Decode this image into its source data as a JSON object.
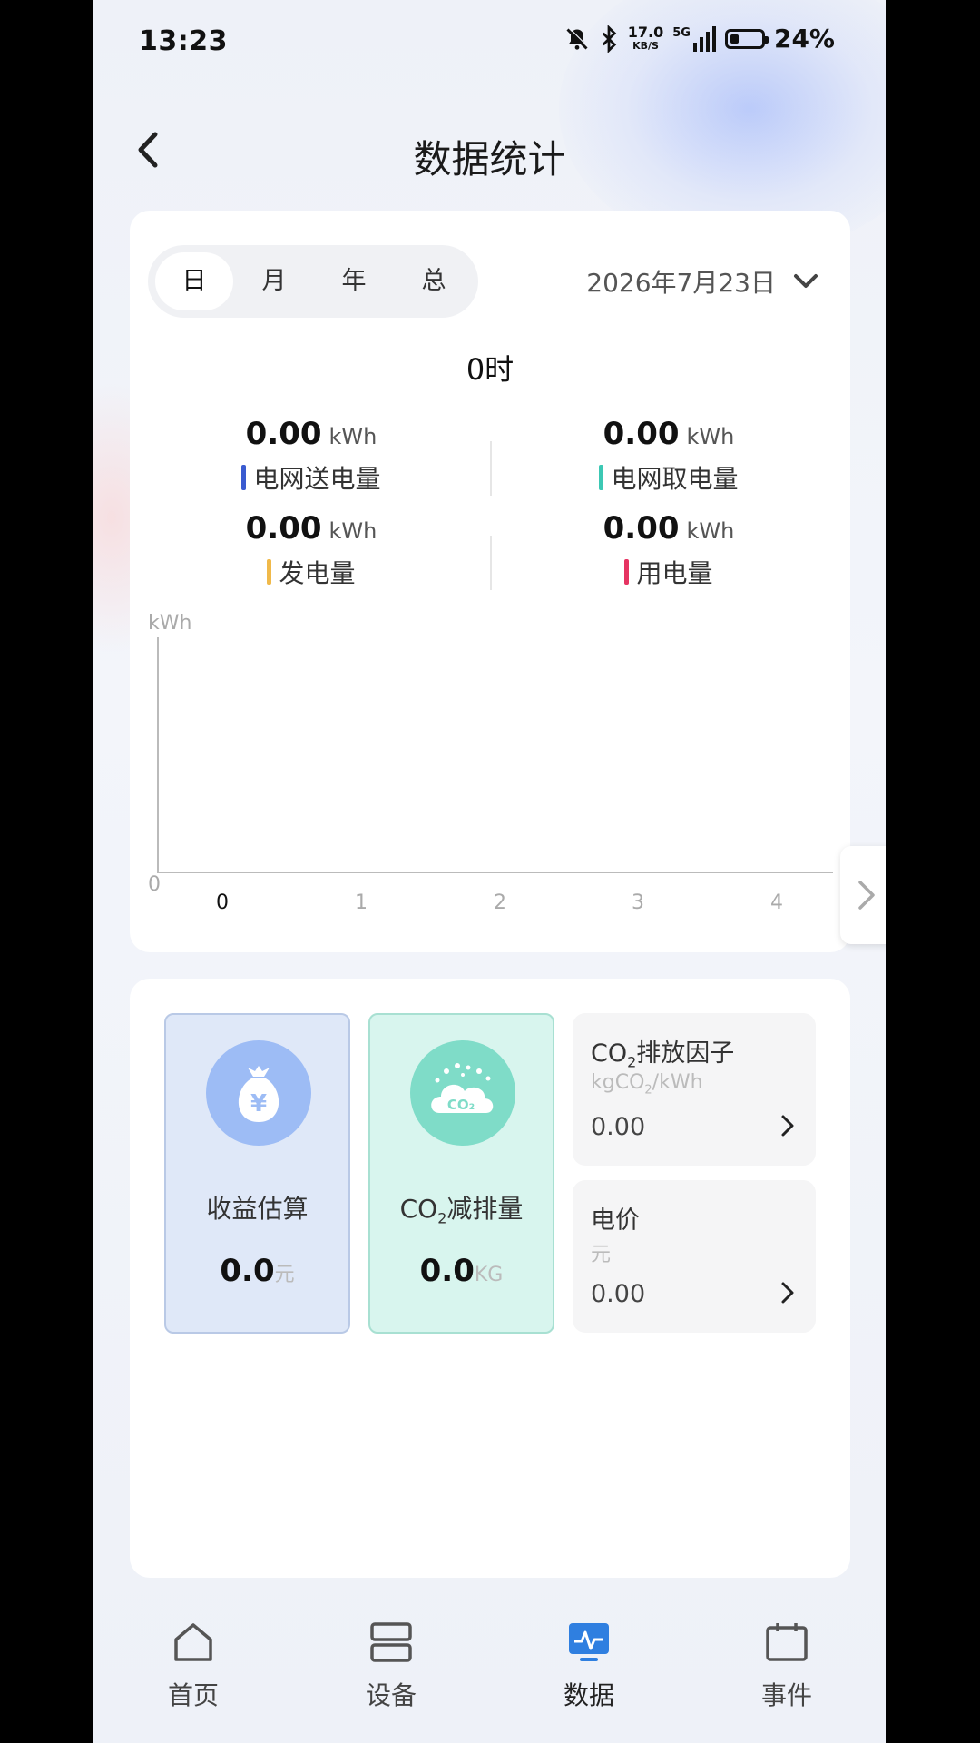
{
  "status_bar": {
    "time": "13:23",
    "net_speed": "17.0",
    "net_unit": "KB/S",
    "network": "5G",
    "battery": "24%",
    "battery_level": 0.24
  },
  "header": {
    "title": "数据统计"
  },
  "period_tabs": [
    {
      "label": "日",
      "active": true
    },
    {
      "label": "月",
      "active": false
    },
    {
      "label": "年",
      "active": false
    },
    {
      "label": "总",
      "active": false
    }
  ],
  "date_picker": {
    "value": "2026年7月23日"
  },
  "hour_label": "0时",
  "stats": {
    "grid_export": {
      "value": "0.00",
      "unit": "kWh",
      "label": "电网送电量",
      "color": "#3a5bd0"
    },
    "grid_import": {
      "value": "0.00",
      "unit": "kWh",
      "label": "电网取电量",
      "color": "#3cc8b4"
    },
    "generation": {
      "value": "0.00",
      "unit": "kWh",
      "label": "发电量",
      "color": "#f0b94a"
    },
    "consumption": {
      "value": "0.00",
      "unit": "kWh",
      "label": "用电量",
      "color": "#e63462"
    }
  },
  "chart": {
    "y_unit": "kWh",
    "y_zero": "0",
    "x_ticks": [
      "0",
      "1",
      "2",
      "3",
      "4"
    ]
  },
  "income": {
    "label": "收益估算",
    "value": "0.0",
    "unit": "元"
  },
  "co2_reduction": {
    "label_prefix": "CO",
    "label_sub": "2",
    "label_suffix": "减排量",
    "value": "0.0",
    "unit": "KG"
  },
  "co2_factor": {
    "title_prefix": "CO",
    "title_sub": "2",
    "title_suffix": "排放因子",
    "unit_prefix": "kgCO",
    "unit_sub": "2",
    "unit_suffix": "/kWh",
    "value": "0.00"
  },
  "price": {
    "title": "电价",
    "unit": "元",
    "value": "0.00"
  },
  "nav": {
    "home": "首页",
    "devices": "设备",
    "data": "数据",
    "events": "事件"
  },
  "colors": {
    "accent": "#2f7fe0",
    "income_circle": "#9dbcf5",
    "co2_circle": "#7fdcc8"
  }
}
